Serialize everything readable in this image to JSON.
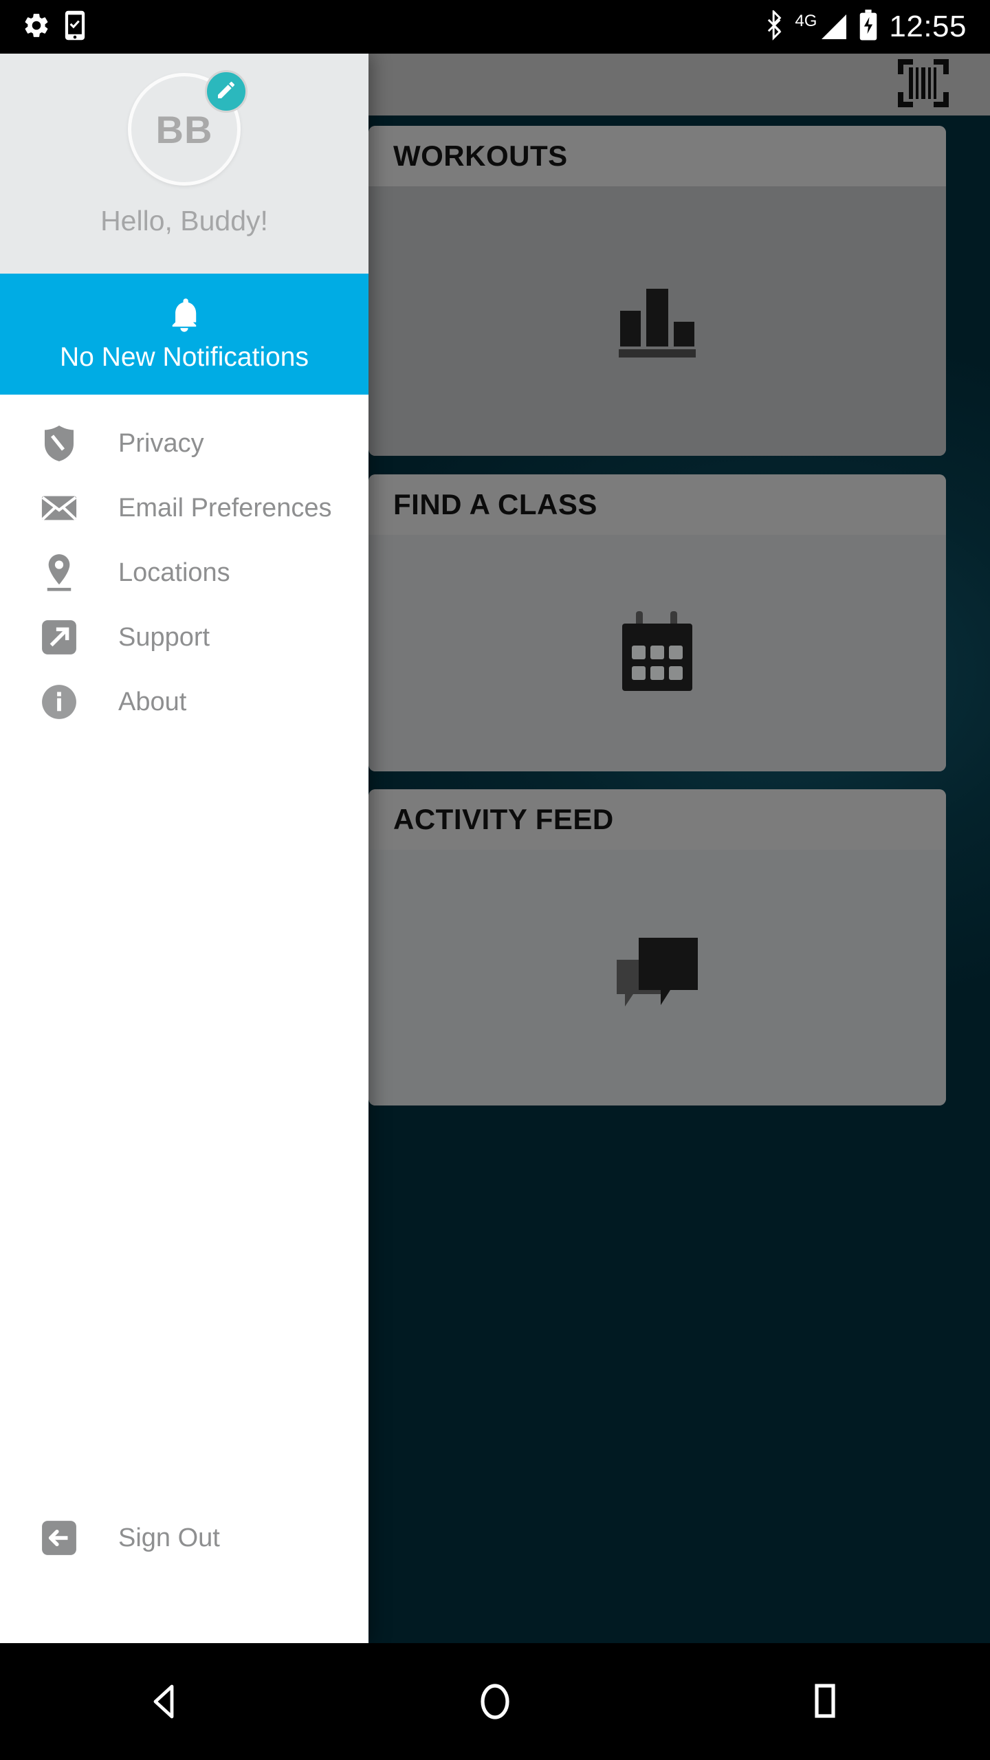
{
  "status_bar": {
    "time": "12:55",
    "left_icons": [
      "gear-icon",
      "phone-checkmark-icon"
    ],
    "right_icons": [
      "bluetooth-icon",
      "signal-4g-icon",
      "battery-charging-icon"
    ],
    "network_label": "4G",
    "background_color": "#000000"
  },
  "drawer": {
    "profile": {
      "initials": "BB",
      "greeting": "Hello, Buddy!",
      "edit_icon": "pencil-icon",
      "edit_badge_color": "#2bb8bd",
      "header_background": "#e7e9ea"
    },
    "notification": {
      "label": "No New Notifications",
      "icon": "bell-icon",
      "background_color": "#00ace4",
      "text_color": "#ffffff"
    },
    "menu_items": [
      {
        "label": "Privacy",
        "icon": "shield-icon"
      },
      {
        "label": "Email Preferences",
        "icon": "envelope-icon"
      },
      {
        "label": "Locations",
        "icon": "map-pin-icon"
      },
      {
        "label": "Support",
        "icon": "external-link-icon"
      },
      {
        "label": "About",
        "icon": "info-circle-icon"
      }
    ],
    "sign_out": {
      "label": "Sign Out",
      "icon": "sign-out-icon"
    },
    "background_color": "#ffffff",
    "icon_color": "#8e8f90"
  },
  "background_app": {
    "top_bar": {
      "scan_icon": "barcode-scan-icon"
    },
    "cards": [
      {
        "title": "WORKOUTS",
        "icon": "bar-chart-icon"
      },
      {
        "title": "FIND A CLASS",
        "icon": "calendar-icon"
      },
      {
        "title": "ACTIVITY FEED",
        "icon": "chat-bubbles-icon"
      }
    ]
  },
  "nav_bar": {
    "buttons": [
      {
        "name": "back",
        "icon": "triangle-back-icon"
      },
      {
        "name": "home",
        "icon": "circle-home-icon"
      },
      {
        "name": "recents",
        "icon": "square-recents-icon"
      }
    ]
  }
}
